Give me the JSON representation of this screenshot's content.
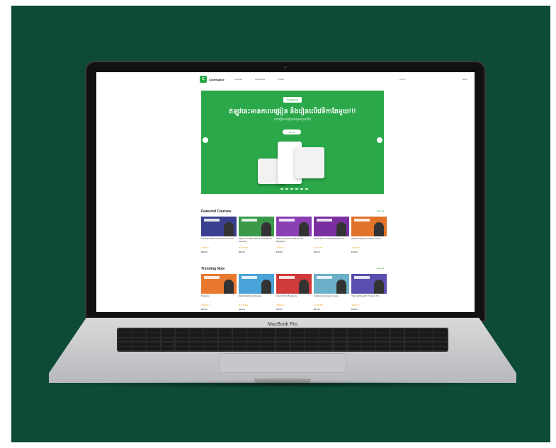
{
  "laptop": {
    "model_label": "MacBook Pro"
  },
  "site": {
    "brand": "CodeSpace",
    "nav": [
      "Courses",
      "Instructors",
      "Pricing"
    ],
    "search_placeholder": "Search",
    "lang": "ENG"
  },
  "hero": {
    "logo_text": "CodeSpace",
    "title": "ឥឡូវនេះ​មានការ​បង្រៀន និងរៀនលើ​វេទិកាតែមួយ!!!",
    "subtitle": "ចាប់ផ្តើម​ការរៀនជាមួយ​ពួកយើង",
    "button": "Join us"
  },
  "featured": {
    "title": "Featured Courses",
    "view_all": "View all",
    "courses": [
      {
        "title": "Full Stack Web Development Course",
        "price": "$20.00",
        "stars": "★★★★☆",
        "color": "#3a3f8f"
      },
      {
        "title": "Python for Data Science and Machine Learning",
        "price": "$25.00",
        "stars": "★★★★★",
        "color": "#3b9a4a"
      },
      {
        "title": "Web Development Full Course Bootcamp",
        "price": "$18.00",
        "stars": "★★★★☆",
        "color": "#8a3fb5"
      },
      {
        "title": "React Native Mobile Development",
        "price": "$22.00",
        "stars": "★★★★☆",
        "color": "#7a2fa0"
      },
      {
        "title": "Graphic Design Complete Course",
        "price": "$15.00",
        "stars": "★★★★★",
        "color": "#e0722a"
      }
    ]
  },
  "trending": {
    "title": "Trending Now",
    "view_all": "View all",
    "courses": [
      {
        "title": "Illustrator",
        "price": "$20.00",
        "stars": "★★★★☆",
        "color": "#e8792f"
      },
      {
        "title": "Digital Marketing Strategy",
        "price": "$18.00",
        "stars": "★★★★★",
        "color": "#4aa3d8"
      },
      {
        "title": "AutoCAD for Beginners",
        "price": "$16.00",
        "stars": "★★★★☆",
        "color": "#d13a3a"
      },
      {
        "title": "Architectural Design Course",
        "price": "$24.00",
        "stars": "★★★★★",
        "color": "#6ab0c8"
      },
      {
        "title": "Video Editing with Premiere Pro",
        "price": "$19.00",
        "stars": "★★★★☆",
        "color": "#5a4fb0"
      }
    ]
  }
}
